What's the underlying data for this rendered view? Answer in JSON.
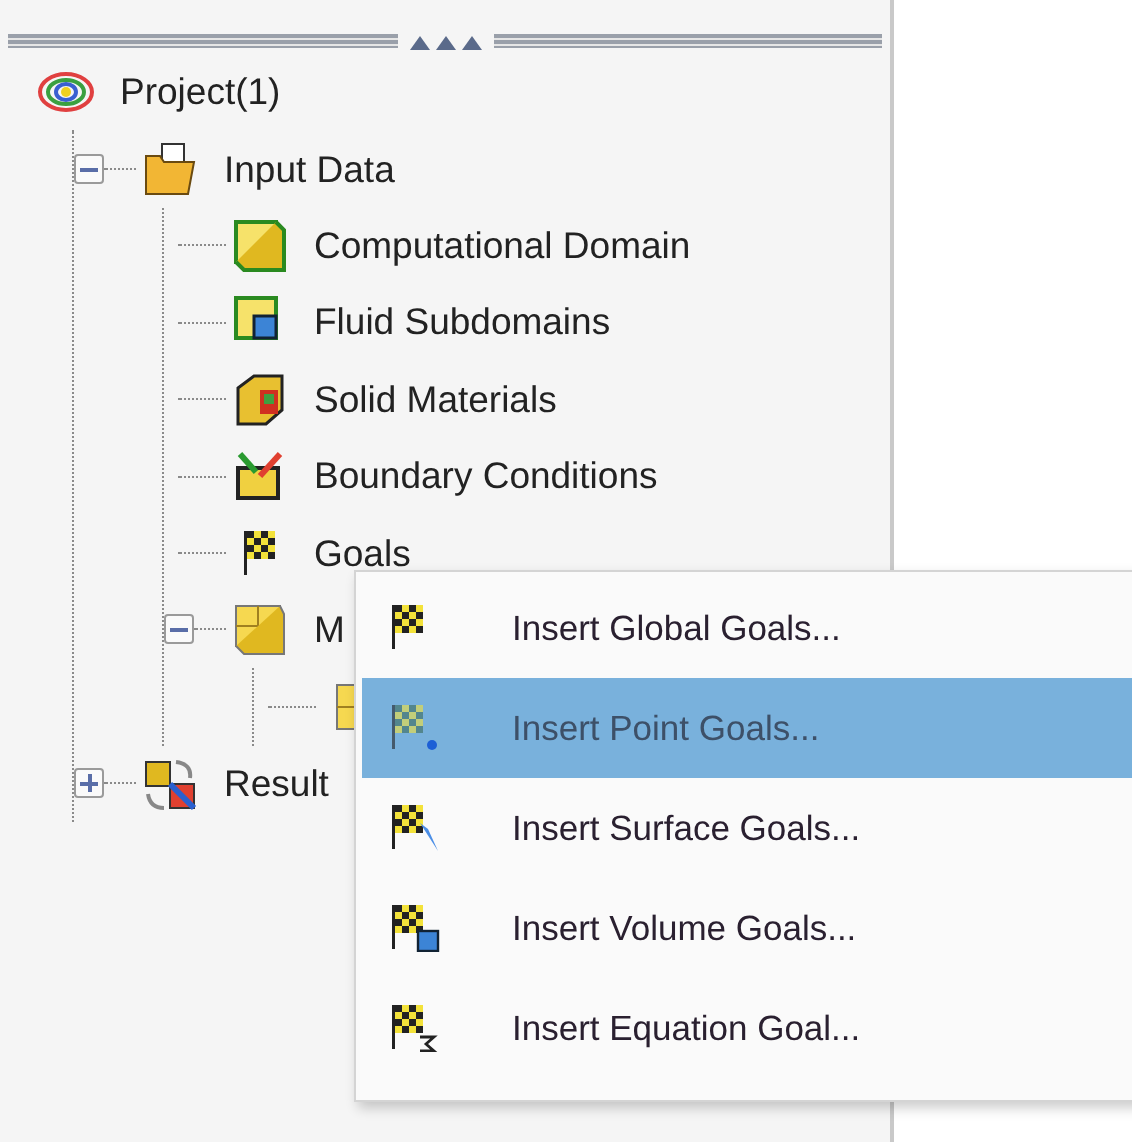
{
  "tree": [
    {
      "label": "Project(1)",
      "kind": "project",
      "children": [
        {
          "label": "Input Data",
          "kind": "folder",
          "expanded": true,
          "children": [
            {
              "label": "Computational Domain",
              "kind": "domain"
            },
            {
              "label": "Fluid Subdomains",
              "kind": "fluid"
            },
            {
              "label": "Solid Materials",
              "kind": "solid"
            },
            {
              "label": "Boundary Conditions",
              "kind": "boundary"
            },
            {
              "label": "Goals",
              "kind": "goals"
            },
            {
              "label": "M",
              "kind": "mesh",
              "expanded": true,
              "children": [
                {
                  "kind": "meshitem"
                }
              ]
            }
          ]
        },
        {
          "label": "Result",
          "kind": "results",
          "expanded": false
        }
      ]
    }
  ],
  "menu": [
    {
      "label": "Insert Global Goals...",
      "kind": "global",
      "selected": false
    },
    {
      "label": "Insert Point Goals...",
      "kind": "point",
      "selected": true
    },
    {
      "label": "Insert Surface Goals...",
      "kind": "surface",
      "selected": false
    },
    {
      "label": "Insert Volume Goals...",
      "kind": "volume",
      "selected": false
    },
    {
      "label": "Insert Equation Goal...",
      "kind": "equation",
      "selected": false
    }
  ]
}
